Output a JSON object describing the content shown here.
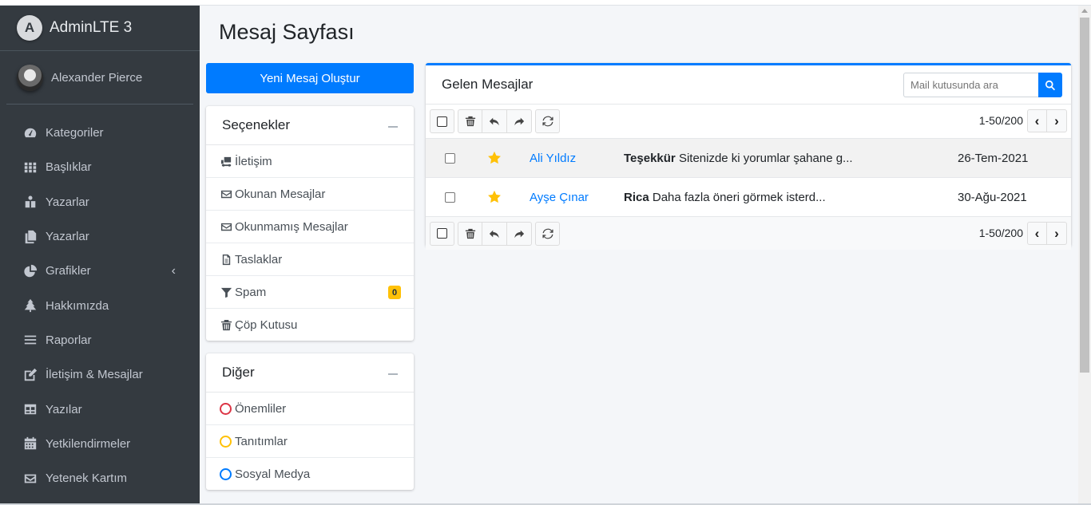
{
  "app": {
    "brand": "AdminLTE 3",
    "brand_logo_letter": "A"
  },
  "user": {
    "name": "Alexander Pierce"
  },
  "sidebar": {
    "items": [
      {
        "label": "Kategoriler",
        "icon": "tachometer-icon"
      },
      {
        "label": "Başlıklar",
        "icon": "grid-icon"
      },
      {
        "label": "Yazarlar",
        "icon": "users-icon"
      },
      {
        "label": "Yazarlar",
        "icon": "copy-icon"
      },
      {
        "label": "Grafikler",
        "icon": "pie-chart-icon",
        "has_caret": true
      },
      {
        "label": "Hakkımızda",
        "icon": "tree-icon"
      },
      {
        "label": "Raporlar",
        "icon": "bars-icon"
      },
      {
        "label": "İletişim & Mesajlar",
        "icon": "edit-icon"
      },
      {
        "label": "Yazılar",
        "icon": "table-icon"
      },
      {
        "label": "Yetkilendirmeler",
        "icon": "calendar-icon"
      },
      {
        "label": "Yetenek Kartım",
        "icon": "envelope-icon"
      }
    ],
    "caret": "‹"
  },
  "page": {
    "title": "Mesaj Sayfası"
  },
  "compose_button": "Yeni Mesaj Oluştur",
  "options_card": {
    "title": "Seçenekler",
    "items": [
      {
        "label": "İletişim",
        "icon": "shipping-icon"
      },
      {
        "label": "Okunan Mesajlar",
        "icon": "envelope-icon"
      },
      {
        "label": "Okunmamış Mesajlar",
        "icon": "envelope-icon"
      },
      {
        "label": "Taslaklar",
        "icon": "file-icon"
      },
      {
        "label": "Spam",
        "icon": "filter-icon",
        "badge": "0"
      },
      {
        "label": "Çöp Kutusu",
        "icon": "trash-icon"
      }
    ]
  },
  "other_card": {
    "title": "Diğer",
    "items": [
      {
        "label": "Önemliler",
        "color": "#dc3545"
      },
      {
        "label": "Tanıtımlar",
        "color": "#ffc107"
      },
      {
        "label": "Sosyal Medya",
        "color": "#007bff"
      }
    ]
  },
  "inbox": {
    "title": "Gelen Mesajlar",
    "search_placeholder": "Mail kutusunda ara",
    "pager": "1-50/200",
    "pager_prev": "‹",
    "pager_next": "›",
    "messages": [
      {
        "from": "Ali Yıldız",
        "subject": "Teşekkür",
        "preview": "Sitenizde ki yorumlar şahane g...",
        "date": "26-Tem-2021",
        "starred": true
      },
      {
        "from": "Ayşe Çınar",
        "subject": "Rica",
        "preview": "Daha fazla öneri görmek isterd...",
        "date": "30-Ağu-2021",
        "starred": true
      }
    ]
  },
  "colors": {
    "primary": "#007bff",
    "sidebar_bg": "#343a40",
    "badge": "#ffc107",
    "star": "#ffc107"
  }
}
